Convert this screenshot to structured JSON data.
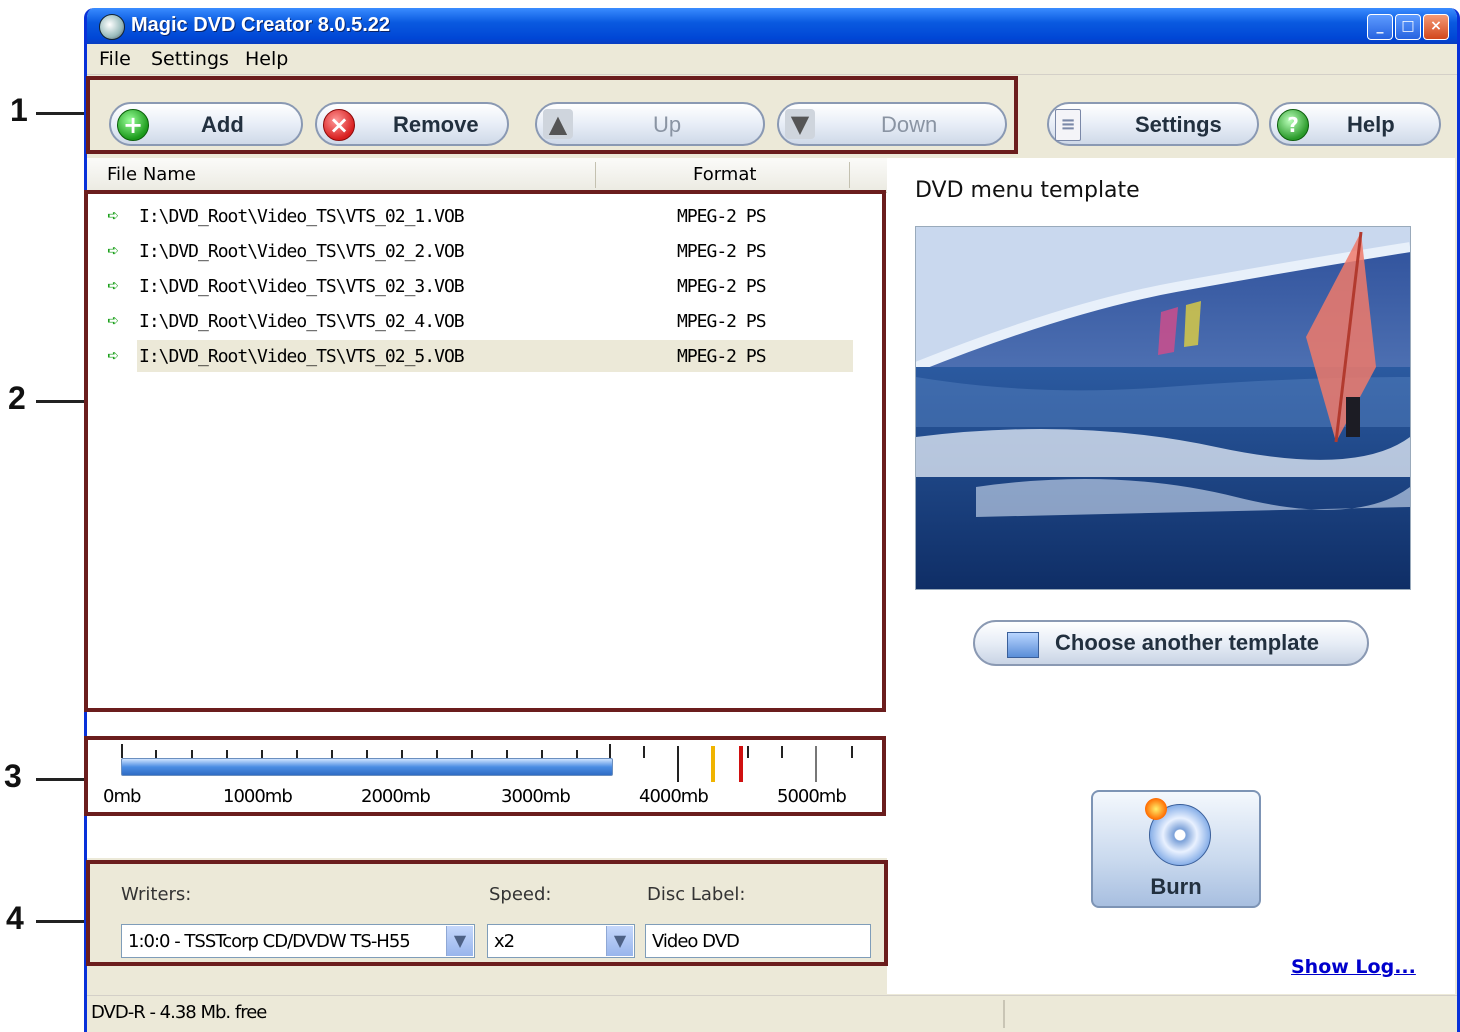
{
  "callouts": [
    "1",
    "2",
    "3",
    "4"
  ],
  "window": {
    "title": "Magic DVD Creator 8.0.5.22",
    "controls": [
      "_",
      "□",
      "×"
    ]
  },
  "menu": [
    "File",
    "Settings",
    "Help"
  ],
  "toolbar": {
    "add": "Add",
    "remove": "Remove",
    "up": "Up",
    "down": "Down",
    "settings": "Settings",
    "help": "Help"
  },
  "file_list": {
    "columns": [
      "File Name",
      "Format"
    ],
    "rows": [
      {
        "name": "I:\\DVD_Root\\Video_TS\\VTS_02_1.VOB",
        "format": "MPEG-2 PS"
      },
      {
        "name": "I:\\DVD_Root\\Video_TS\\VTS_02_2.VOB",
        "format": "MPEG-2 PS"
      },
      {
        "name": "I:\\DVD_Root\\Video_TS\\VTS_02_3.VOB",
        "format": "MPEG-2 PS"
      },
      {
        "name": "I:\\DVD_Root\\Video_TS\\VTS_02_4.VOB",
        "format": "MPEG-2 PS"
      },
      {
        "name": "I:\\DVD_Root\\Video_TS\\VTS_02_5.VOB",
        "format": "MPEG-2 PS"
      }
    ],
    "selected_index": 4
  },
  "disc_space": {
    "scale_labels": [
      "0mb",
      "1000mb",
      "2000mb",
      "3000mb",
      "4000mb",
      "5000mb"
    ],
    "marker_colors": {
      "yellow": "#f0b400",
      "red": "#d01010"
    }
  },
  "burn_settings": {
    "writers_label": "Writers:",
    "writer_value": "1:0:0 - TSSTcorp CD/DVDW TS-H55",
    "speed_label": "Speed:",
    "speed_value": "x2",
    "disc_label_label": "Disc Label:",
    "disc_label_value": "Video DVD"
  },
  "template": {
    "title": "DVD menu template",
    "choose_button": "Choose another template"
  },
  "burn_button": "Burn",
  "show_log": "Show Log...",
  "status": {
    "text": "DVD-R - 4.38 Mb. free"
  },
  "colors": {
    "accent": "#0046d5",
    "highlight_box": "#6b1d1d",
    "link": "#0000cc"
  }
}
